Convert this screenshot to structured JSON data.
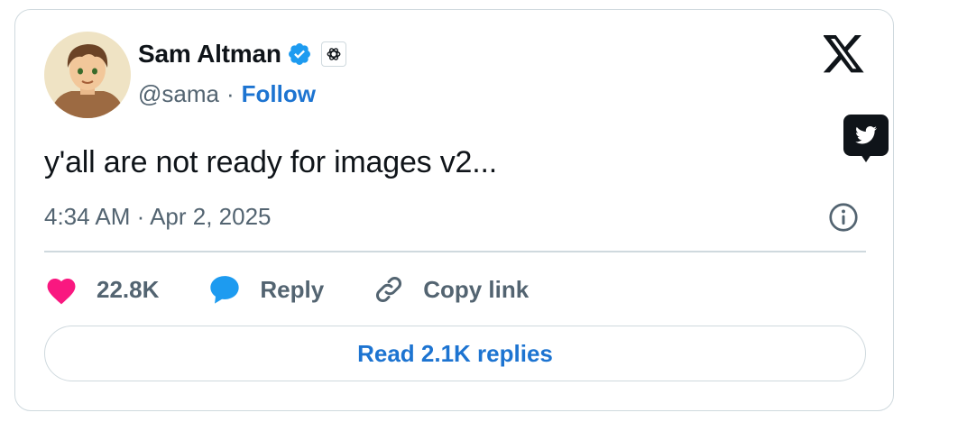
{
  "author": {
    "name": "Sam Altman",
    "handle": "@sama",
    "separator": "·",
    "follow_label": "Follow",
    "verified_color": "#1d9bf0",
    "avatar_icon": "avatar-illustration",
    "affiliate_icon": "openai-logo-icon"
  },
  "tweet": {
    "text": "y'all are not ready for images v2...",
    "timestamp": "4:34 AM · Apr 2, 2025"
  },
  "actions": {
    "likes": "22.8K",
    "reply_label": "Reply",
    "copy_link_label": "Copy link",
    "like_color": "#f91880",
    "reply_color": "#1d9bf0"
  },
  "replies_button": {
    "label": "Read 2.1K replies"
  },
  "icons": {
    "brand": "x-logo-icon",
    "badge": "twitter-bird-icon",
    "info": "info-icon"
  }
}
